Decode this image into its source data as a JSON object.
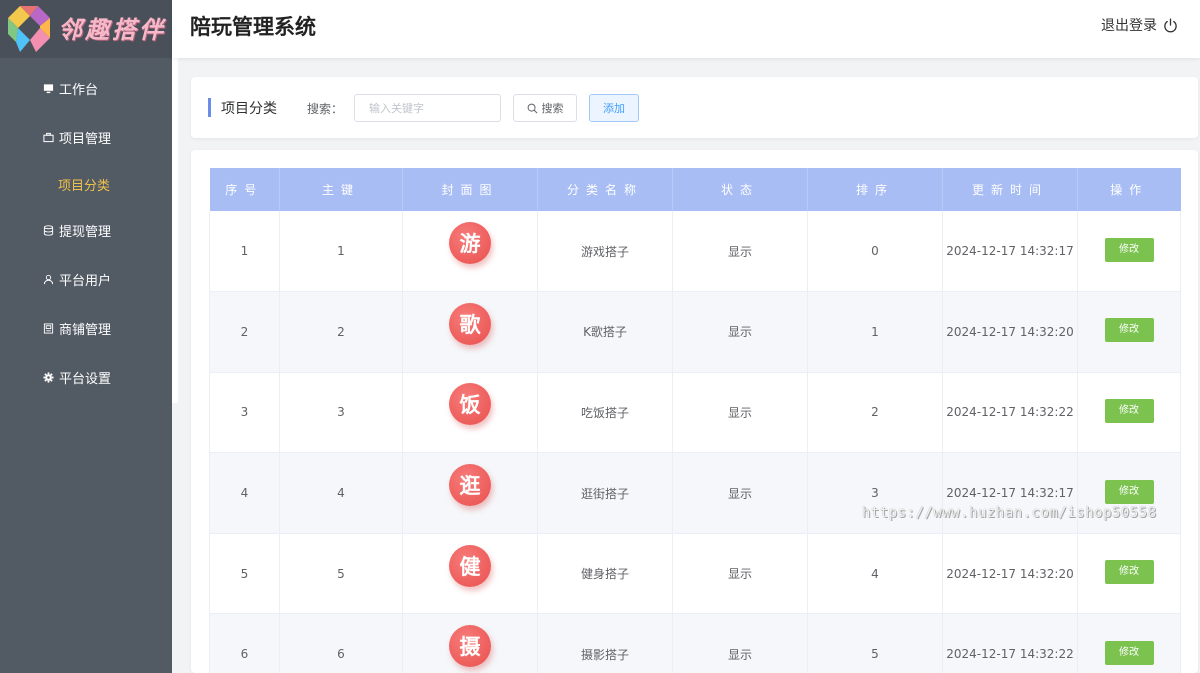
{
  "app": {
    "logo_text": "邻趣搭伴",
    "title": "陪玩管理系统",
    "logout_label": "退出登录"
  },
  "sidebar": {
    "items": [
      {
        "label": "工作台",
        "icon": "monitor-icon"
      },
      {
        "label": "项目管理",
        "icon": "briefcase-icon"
      },
      {
        "label": "项目分类",
        "icon": "",
        "active": true
      },
      {
        "label": "提现管理",
        "icon": "database-icon"
      },
      {
        "label": "平台用户",
        "icon": "user-icon"
      },
      {
        "label": "商铺管理",
        "icon": "shop-icon"
      },
      {
        "label": "平台设置",
        "icon": "gear-icon"
      }
    ]
  },
  "search_panel": {
    "title": "项目分类",
    "search_label": "搜索：",
    "search_placeholder": "输入关键字",
    "search_button": "搜索",
    "add_button": "添加"
  },
  "table": {
    "columns": [
      "序号",
      "主键",
      "封面图",
      "分类名称",
      "状态",
      "排序",
      "更新时间",
      "操作"
    ],
    "rows": [
      {
        "index": "1",
        "id": "1",
        "cover": "游",
        "name": "游戏搭子",
        "status": "显示",
        "sort": "0",
        "updated": "2024-12-17 14:32:17",
        "action": "修改"
      },
      {
        "index": "2",
        "id": "2",
        "cover": "歌",
        "name": "K歌搭子",
        "status": "显示",
        "sort": "1",
        "updated": "2024-12-17 14:32:20",
        "action": "修改"
      },
      {
        "index": "3",
        "id": "3",
        "cover": "饭",
        "name": "吃饭搭子",
        "status": "显示",
        "sort": "2",
        "updated": "2024-12-17 14:32:22",
        "action": "修改"
      },
      {
        "index": "4",
        "id": "4",
        "cover": "逛",
        "name": "逛街搭子",
        "status": "显示",
        "sort": "3",
        "updated": "2024-12-17 14:32:17",
        "action": "修改"
      },
      {
        "index": "5",
        "id": "5",
        "cover": "健",
        "name": "健身搭子",
        "status": "显示",
        "sort": "4",
        "updated": "2024-12-17 14:32:20",
        "action": "修改"
      },
      {
        "index": "6",
        "id": "6",
        "cover": "摄",
        "name": "摄影搭子",
        "status": "显示",
        "sort": "5",
        "updated": "2024-12-17 14:32:22",
        "action": "修改"
      }
    ]
  },
  "watermark": "https://www.huzhan.com/ishop50558",
  "colors": {
    "sidebar_bg": "#525a64",
    "active_nav": "#f0c24b",
    "table_header": "#a8bdf4",
    "cover_red": "#e84f4d",
    "edit_green": "#7bc24f",
    "add_blue": "#409eff"
  }
}
